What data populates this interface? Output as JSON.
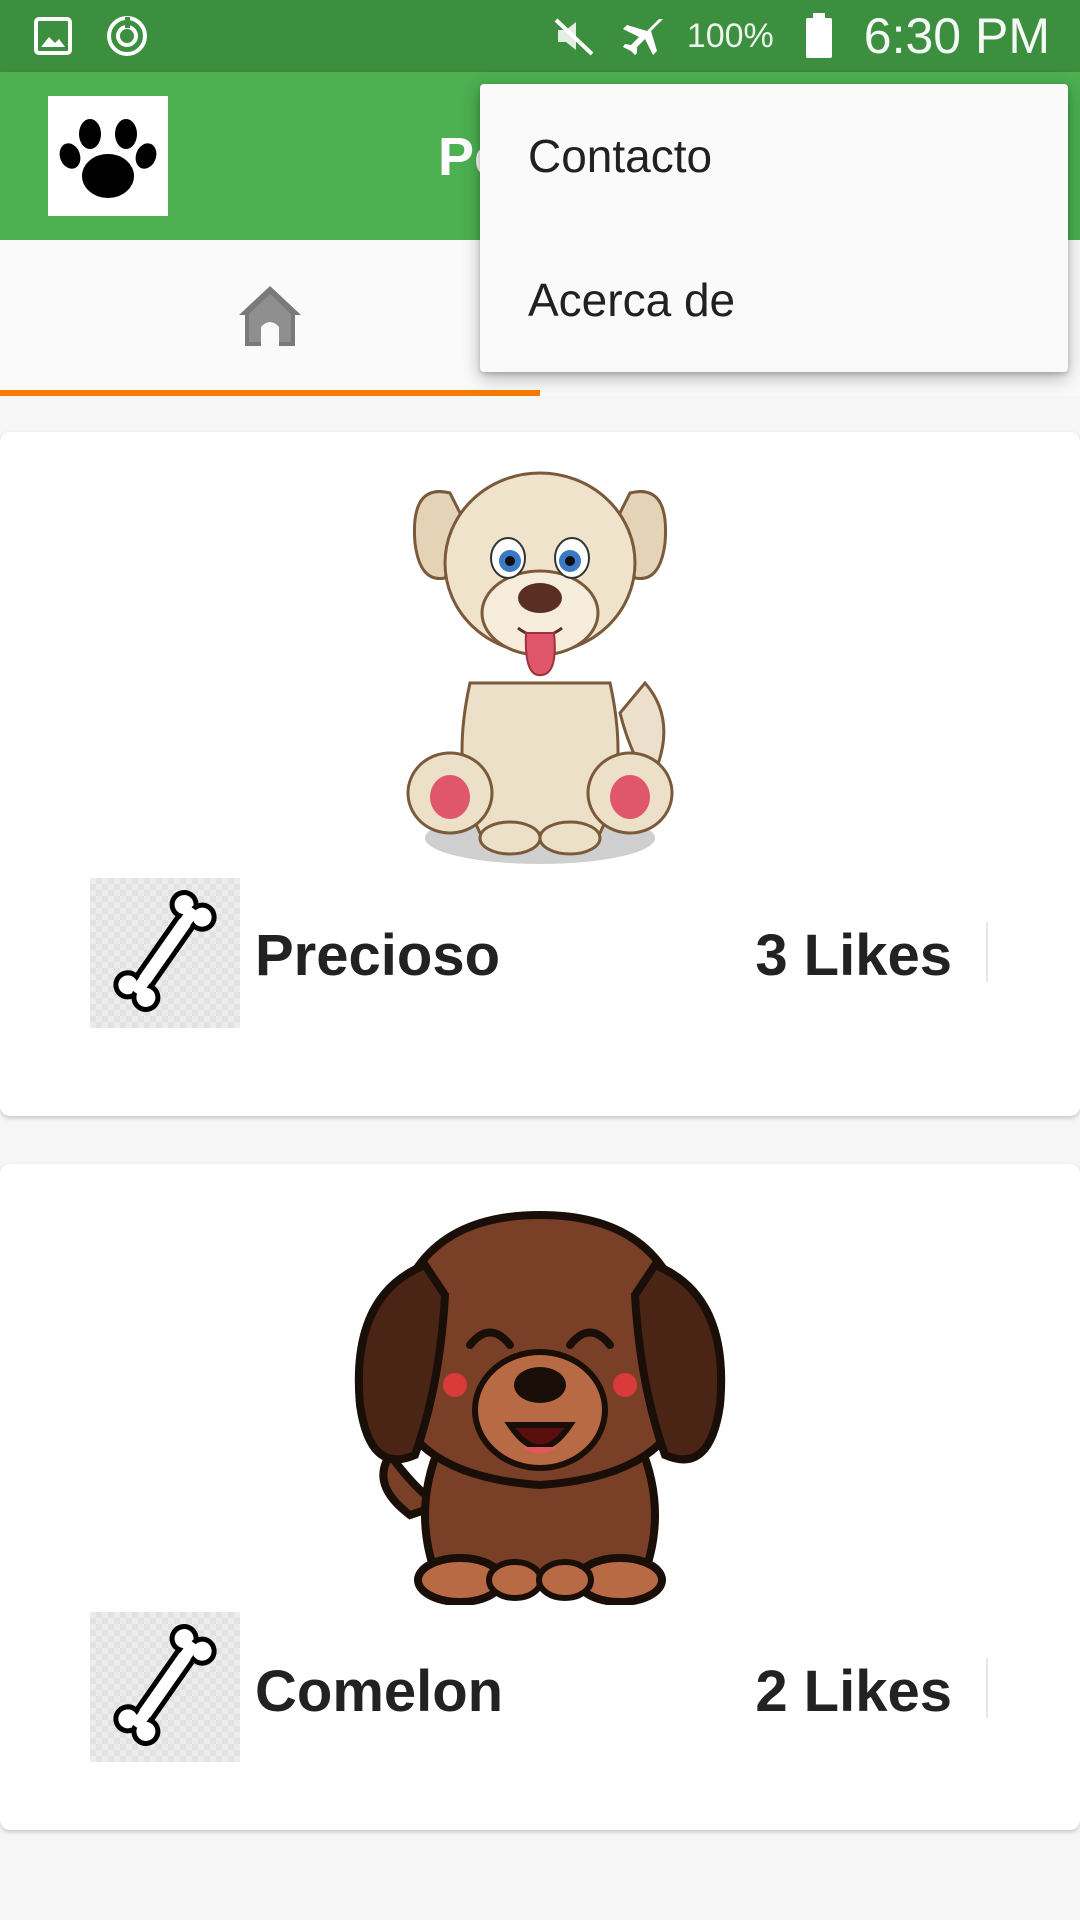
{
  "status_bar": {
    "battery_percent": "100%",
    "time": "6:30 PM",
    "icons": [
      "gallery-icon",
      "sync-icon",
      "mute-icon",
      "airplane-mode-icon",
      "battery-icon"
    ]
  },
  "app_bar": {
    "title": "Petagram",
    "logo_icon": "paw-icon"
  },
  "tabs": [
    {
      "icon": "doghouse-icon",
      "active": true
    }
  ],
  "menu": {
    "items": [
      {
        "label": "Contacto"
      },
      {
        "label": "Acerca de"
      }
    ]
  },
  "pets": [
    {
      "name": "Precioso",
      "likes": "3 Likes",
      "image": "puppy-beige-illustration"
    },
    {
      "name": "Comelon",
      "likes": "2 Likes",
      "image": "puppy-brown-illustration"
    }
  ],
  "colors": {
    "status_bar": "#3d8f40",
    "primary": "#4caf50",
    "accent": "#f57c00"
  }
}
